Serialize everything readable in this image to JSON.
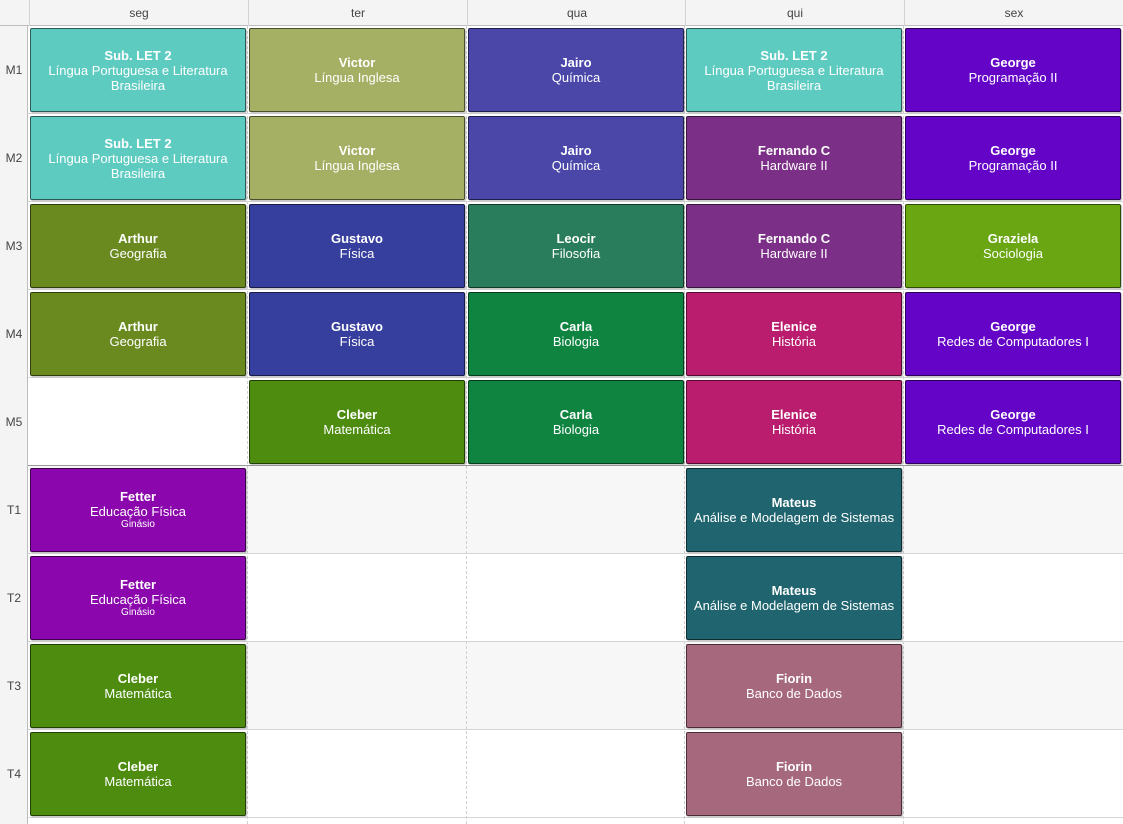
{
  "days": [
    "seg",
    "ter",
    "qua",
    "qui",
    "sex"
  ],
  "rows": [
    {
      "label": "M1"
    },
    {
      "label": "M2"
    },
    {
      "label": "M3"
    },
    {
      "label": "M4"
    },
    {
      "label": "M5"
    },
    {
      "label": "T1"
    },
    {
      "label": "T2"
    },
    {
      "label": "T3"
    },
    {
      "label": "T4"
    }
  ],
  "colors": {
    "let2": "#5ecbc1",
    "ingles": "#a5b064",
    "quimica": "#4a47a9",
    "programacao": "#6404c7",
    "hardware": "#7b2f86",
    "geografia": "#6a8a20",
    "fisica": "#373f9e",
    "filosofia": "#2a7d5c",
    "sociologia": "#6aa512",
    "biologia": "#0f8441",
    "historia": "#ba1d6e",
    "redes": "#6404c7",
    "matematica": "#4d8c0f",
    "edfisica": "#8b06ad",
    "analise": "#1f646e",
    "banco": "#a6687d"
  },
  "classes": [
    {
      "row": 0,
      "day": 0,
      "teacher": "Sub. LET 2",
      "subject": "Língua Portuguesa e Literatura Brasileira",
      "color": "#5ecbc1"
    },
    {
      "row": 0,
      "day": 1,
      "teacher": "Victor",
      "subject": "Língua Inglesa",
      "color": "#a5b064"
    },
    {
      "row": 0,
      "day": 2,
      "teacher": "Jairo",
      "subject": "Química",
      "color": "#4a47a9"
    },
    {
      "row": 0,
      "day": 3,
      "teacher": "Sub. LET 2",
      "subject": "Língua Portuguesa e Literatura Brasileira",
      "color": "#5ecbc1"
    },
    {
      "row": 0,
      "day": 4,
      "teacher": "George",
      "subject": "Programação II",
      "color": "#6404c7"
    },
    {
      "row": 1,
      "day": 0,
      "teacher": "Sub. LET 2",
      "subject": "Língua Portuguesa e Literatura Brasileira",
      "color": "#5ecbc1"
    },
    {
      "row": 1,
      "day": 1,
      "teacher": "Victor",
      "subject": "Língua Inglesa",
      "color": "#a5b064"
    },
    {
      "row": 1,
      "day": 2,
      "teacher": "Jairo",
      "subject": "Química",
      "color": "#4a47a9"
    },
    {
      "row": 1,
      "day": 3,
      "teacher": "Fernando C",
      "subject": "Hardware II",
      "color": "#7b2f86"
    },
    {
      "row": 1,
      "day": 4,
      "teacher": "George",
      "subject": "Programação II",
      "color": "#6404c7"
    },
    {
      "row": 2,
      "day": 0,
      "teacher": "Arthur",
      "subject": "Geografia",
      "color": "#6a8a20"
    },
    {
      "row": 2,
      "day": 1,
      "teacher": "Gustavo",
      "subject": "Física",
      "color": "#373f9e"
    },
    {
      "row": 2,
      "day": 2,
      "teacher": "Leocir",
      "subject": "Filosofia",
      "color": "#2a7d5c"
    },
    {
      "row": 2,
      "day": 3,
      "teacher": "Fernando C",
      "subject": "Hardware II",
      "color": "#7b2f86"
    },
    {
      "row": 2,
      "day": 4,
      "teacher": "Graziela",
      "subject": "Sociologia",
      "color": "#6aa512"
    },
    {
      "row": 3,
      "day": 0,
      "teacher": "Arthur",
      "subject": "Geografia",
      "color": "#6a8a20"
    },
    {
      "row": 3,
      "day": 1,
      "teacher": "Gustavo",
      "subject": "Física",
      "color": "#373f9e"
    },
    {
      "row": 3,
      "day": 2,
      "teacher": "Carla",
      "subject": "Biologia",
      "color": "#0f8441"
    },
    {
      "row": 3,
      "day": 3,
      "teacher": "Elenice",
      "subject": "História",
      "color": "#ba1d6e"
    },
    {
      "row": 3,
      "day": 4,
      "teacher": "George",
      "subject": "Redes de Computadores I",
      "color": "#6404c7"
    },
    {
      "row": 4,
      "day": 1,
      "teacher": "Cleber",
      "subject": "Matemática",
      "color": "#4d8c0f"
    },
    {
      "row": 4,
      "day": 2,
      "teacher": "Carla",
      "subject": "Biologia",
      "color": "#0f8441"
    },
    {
      "row": 4,
      "day": 3,
      "teacher": "Elenice",
      "subject": "História",
      "color": "#ba1d6e"
    },
    {
      "row": 4,
      "day": 4,
      "teacher": "George",
      "subject": "Redes de Computadores I",
      "color": "#6404c7"
    },
    {
      "row": 5,
      "day": 0,
      "teacher": "Fetter",
      "subject": "Educação Física",
      "room": "Ginásio",
      "color": "#8b06ad"
    },
    {
      "row": 5,
      "day": 3,
      "teacher": "Mateus",
      "subject": "Análise e Modelagem de Sistemas",
      "color": "#1f646e"
    },
    {
      "row": 6,
      "day": 0,
      "teacher": "Fetter",
      "subject": "Educação Física",
      "room": "Ginásio",
      "color": "#8b06ad"
    },
    {
      "row": 6,
      "day": 3,
      "teacher": "Mateus",
      "subject": "Análise e Modelagem de Sistemas",
      "color": "#1f646e"
    },
    {
      "row": 7,
      "day": 0,
      "teacher": "Cleber",
      "subject": "Matemática",
      "color": "#4d8c0f"
    },
    {
      "row": 7,
      "day": 3,
      "teacher": "Fiorin",
      "subject": "Banco de Dados",
      "color": "#a6687d"
    },
    {
      "row": 8,
      "day": 0,
      "teacher": "Cleber",
      "subject": "Matemática",
      "color": "#4d8c0f"
    },
    {
      "row": 8,
      "day": 3,
      "teacher": "Fiorin",
      "subject": "Banco de Dados",
      "color": "#a6687d"
    }
  ]
}
